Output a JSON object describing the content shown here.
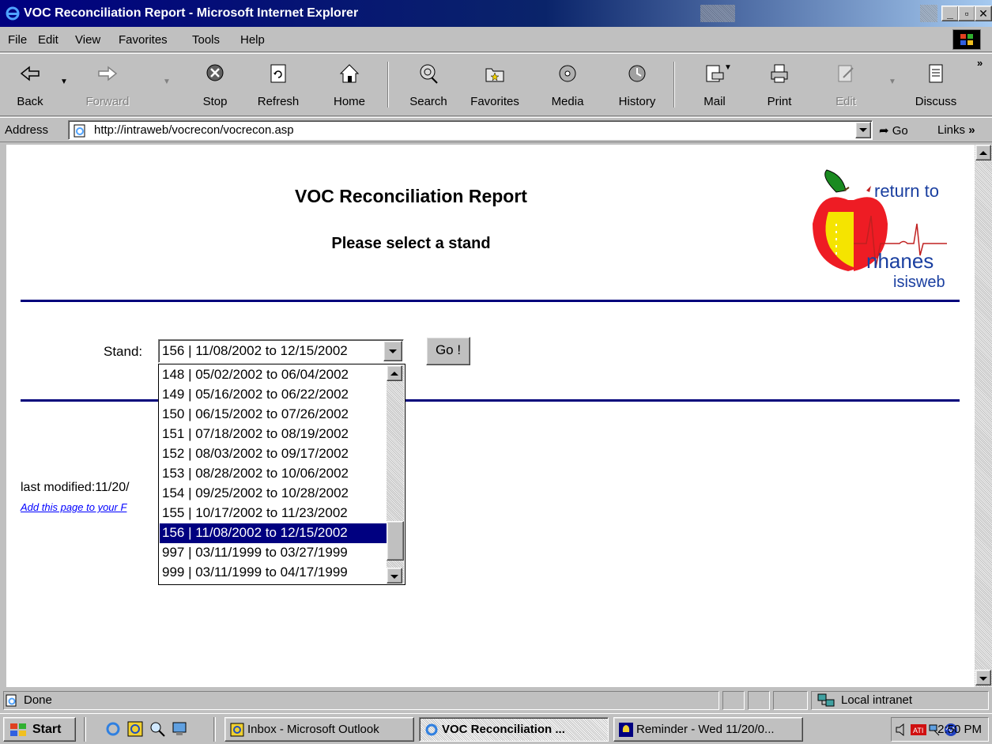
{
  "window": {
    "title": "VOC Reconciliation Report - Microsoft Internet Explorer"
  },
  "menu": [
    "File",
    "Edit",
    "View",
    "Favorites",
    "Tools",
    "Help"
  ],
  "toolbar": {
    "back": "Back",
    "forward": "Forward",
    "stop": "Stop",
    "refresh": "Refresh",
    "home": "Home",
    "search": "Search",
    "favorites": "Favorites",
    "media": "Media",
    "history": "History",
    "mail": "Mail",
    "print": "Print",
    "edit": "Edit",
    "discuss": "Discuss"
  },
  "address": {
    "label": "Address",
    "url": "http://intraweb/vocrecon/vocrecon.asp",
    "go": "Go",
    "links": "Links"
  },
  "page": {
    "title": "VOC Reconciliation Report",
    "subtitle": "Please select a stand",
    "stand_label": "Stand:",
    "selected_stand": "156 | 11/08/2002 to 12/15/2002",
    "go_button": "Go !",
    "stand_options": [
      "148 | 05/02/2002 to 06/04/2002",
      "149 | 05/16/2002 to 06/22/2002",
      "150 | 06/15/2002 to 07/26/2002",
      "151 | 07/18/2002 to 08/19/2002",
      "152 | 08/03/2002 to 09/17/2002",
      "153 | 08/28/2002 to 10/06/2002",
      "154 | 09/25/2002 to 10/28/2002",
      "155 | 10/17/2002 to 11/23/2002",
      "156 | 11/08/2002 to 12/15/2002",
      "997 | 03/11/1999 to 03/27/1999",
      "999 | 03/11/1999 to 04/17/1999"
    ],
    "selected_index": 8,
    "last_modified": "last modified:11/20/",
    "favorites_link": "Add this page to your F",
    "logo": {
      "line1": "return to",
      "line2": "nhanes",
      "line3": "isisweb"
    }
  },
  "status": {
    "text": "Done",
    "zone": "Local intranet"
  },
  "taskbar": {
    "start": "Start",
    "tasks": [
      "Inbox - Microsoft Outlook",
      "VOC Reconciliation ...",
      "Reminder - Wed 11/20/0..."
    ],
    "clock": "2:50 PM"
  },
  "colors": {
    "title_bar": "#000080",
    "selection": "#000080",
    "rule": "#00007b",
    "link": "#0000ff"
  }
}
